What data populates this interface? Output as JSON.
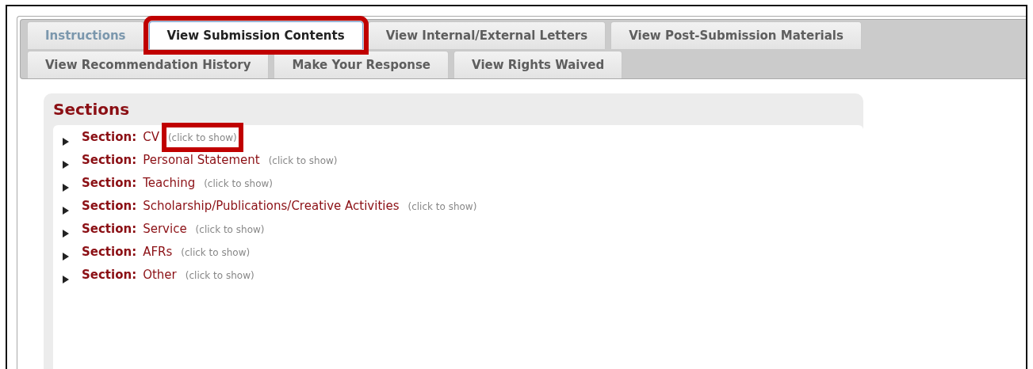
{
  "tab_rows": [
    {
      "tabs": [
        {
          "label": "Instructions",
          "selected": false,
          "visited": true,
          "highlighted": false
        },
        {
          "label": "View Submission Contents",
          "selected": true,
          "visited": false,
          "highlighted": true
        },
        {
          "label": "View Internal/External Letters",
          "selected": false,
          "visited": false,
          "highlighted": false
        },
        {
          "label": "View Post-Submission Materials",
          "selected": false,
          "visited": false,
          "highlighted": false
        }
      ]
    },
    {
      "tabs": [
        {
          "label": "View Recommendation History",
          "selected": false,
          "visited": false,
          "highlighted": false
        },
        {
          "label": "Make Your Response",
          "selected": false,
          "visited": false,
          "highlighted": false
        },
        {
          "label": "View Rights Waived",
          "selected": false,
          "visited": false,
          "highlighted": false
        }
      ]
    }
  ],
  "sections": {
    "title": "Sections",
    "items": [
      {
        "prefix": "Section:",
        "name": "CV",
        "hint": "(click to show)",
        "highlighted": true
      },
      {
        "prefix": "Section:",
        "name": "Personal Statement",
        "hint": "(click to show)",
        "highlighted": false
      },
      {
        "prefix": "Section:",
        "name": "Teaching",
        "hint": "(click to show)",
        "highlighted": false
      },
      {
        "prefix": "Section:",
        "name": "Scholarship/Publications/Creative Activities",
        "hint": "(click to show)",
        "highlighted": false
      },
      {
        "prefix": "Section:",
        "name": "Service",
        "hint": "(click to show)",
        "highlighted": false
      },
      {
        "prefix": "Section:",
        "name": "AFRs",
        "hint": "(click to show)",
        "highlighted": false
      },
      {
        "prefix": "Section:",
        "name": "Other",
        "hint": "(click to show)",
        "highlighted": false
      }
    ]
  }
}
